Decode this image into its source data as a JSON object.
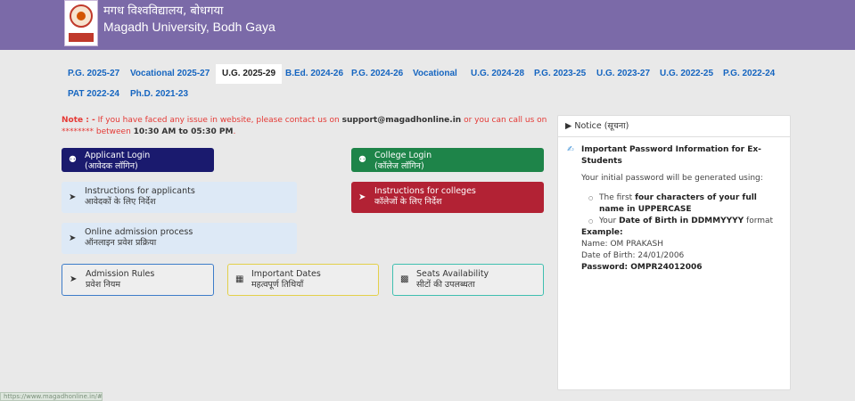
{
  "header": {
    "title_hindi": "मगध विश्वविद्यालय, बोधगया",
    "title_english": "Magadh University, Bodh Gaya"
  },
  "tabs": [
    {
      "label": "P.G. 2025-27"
    },
    {
      "label": "Vocational 2025-27"
    },
    {
      "label": "U.G. 2025-29",
      "active": true
    },
    {
      "label": "B.Ed. 2024-26"
    },
    {
      "label": "P.G. 2024-26"
    },
    {
      "label": "Vocational"
    },
    {
      "label": "U.G. 2024-28"
    },
    {
      "label": "P.G. 2023-25"
    },
    {
      "label": "U.G. 2023-27"
    },
    {
      "label": "U.G. 2022-25"
    },
    {
      "label": "P.G. 2022-24"
    },
    {
      "label": "PAT 2022-24"
    },
    {
      "label": "Ph.D. 2021-23"
    }
  ],
  "note": {
    "label": "Note : -",
    "text1": " If you have faced any issue in website, please contact us on ",
    "email": "support@magadhonline.in",
    "text2": " or you can call us on ******** between ",
    "time": "10:30 AM to 05:30 PM",
    "end": "."
  },
  "cards": {
    "applicant_login": {
      "en": "Applicant Login",
      "hi": "(आवेदक लॉगिन)"
    },
    "college_login": {
      "en": "College Login",
      "hi": "(कॉलेज लॉगिन)"
    },
    "instructions_applicants": {
      "en": "Instructions for applicants",
      "hi": "आवेदकों के लिए निर्देश"
    },
    "instructions_colleges": {
      "en": "Instructions for colleges",
      "hi": "कॉलेजों के लिए निर्देश"
    },
    "online_admission": {
      "en": "Online admission process",
      "hi": "ऑनलाइन प्रवेश प्रक्रिया"
    },
    "admission_rules": {
      "en": "Admission Rules",
      "hi": "प्रवेश नियम"
    },
    "important_dates": {
      "en": "Important Dates",
      "hi": "महत्वपूर्ण तिथियाँ"
    },
    "seats_availability": {
      "en": "Seats Availability",
      "hi": "सीटों की उपलब्धता"
    }
  },
  "notice": {
    "heading": "Notice (सूचना)",
    "title": "Important Password Information for Ex-Students",
    "intro": "Your initial password will be generated using:",
    "bullet1_pre": "The first ",
    "bullet1_bold": "four characters of your full name in UPPERCASE",
    "bullet2_pre": "Your ",
    "bullet2_bold": "Date of Birth in DDMMYYYY",
    "bullet2_post": " format",
    "example_label": "Example:",
    "name_line": "Name: OM PRAKASH",
    "dob_line": "Date of Birth: 24/01/2006",
    "password_line": "Password: OMPR24012006"
  },
  "status_url": "https://www.magadhonline.in/#"
}
